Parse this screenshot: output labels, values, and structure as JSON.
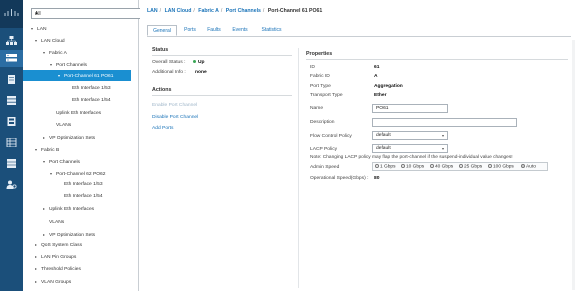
{
  "rail": {
    "icons": [
      "network-icon",
      "equipment-icon",
      "servers-icon",
      "lan-icon",
      "san-icon",
      "vm-icon",
      "storage-icon",
      "chassis-icon",
      "admin-icon"
    ]
  },
  "nav": {
    "filter_value": "All",
    "tree": [
      {
        "label": "LAN",
        "toggle": "▾"
      },
      {
        "label": "LAN Cloud",
        "toggle": "▾"
      },
      {
        "label": "Fabric A",
        "toggle": "▾"
      },
      {
        "label": "Port Channels",
        "toggle": "▾"
      },
      {
        "label": "Port-Channel 61 PO61",
        "toggle": "▾"
      },
      {
        "label": "Eth Interface 1/53",
        "toggle": ""
      },
      {
        "label": "Eth Interface 1/54",
        "toggle": ""
      },
      {
        "label": "Uplink Eth Interfaces",
        "toggle": ""
      },
      {
        "label": "VLANs",
        "toggle": ""
      },
      {
        "label": "VP Optimization Sets",
        "toggle": "▸"
      },
      {
        "label": "Fabric B",
        "toggle": "▾"
      },
      {
        "label": "Port Channels",
        "toggle": "▾"
      },
      {
        "label": "Port-Channel 62 PO62",
        "toggle": "▾"
      },
      {
        "label": "Eth Interface 1/53",
        "toggle": ""
      },
      {
        "label": "Eth Interface 1/54",
        "toggle": ""
      },
      {
        "label": "Uplink Eth Interfaces",
        "toggle": "▸"
      },
      {
        "label": "VLANs",
        "toggle": ""
      },
      {
        "label": "VP Optimization Sets",
        "toggle": "▸"
      },
      {
        "label": "QoS System Class",
        "toggle": "▸"
      },
      {
        "label": "LAN Pin Groups",
        "toggle": "▸"
      },
      {
        "label": "Threshold Policies",
        "toggle": "▸"
      },
      {
        "label": "VLAN Groups",
        "toggle": "▸"
      }
    ]
  },
  "breadcrumb": {
    "items": [
      "LAN",
      "LAN Cloud",
      "Fabric A",
      "Port Channels"
    ],
    "current": "Port-Channel 61 PO61",
    "separator": "/"
  },
  "tabs": [
    "General",
    "Ports",
    "Faults",
    "Events",
    "Statistics"
  ],
  "status": {
    "title": "Status",
    "overall_label": "Overall Status :",
    "overall_value": "Up",
    "additional_label": "Additional Info :",
    "additional_value": "none"
  },
  "actions": {
    "title": "Actions",
    "items": [
      "Enable Port Channel",
      "Disable Port Channel",
      "Add Ports"
    ]
  },
  "properties": {
    "title": "Properties",
    "id_label": "ID",
    "id_value": "61",
    "fabric_label": "Fabric ID",
    "fabric_value": "A",
    "port_type_label": "Port Type",
    "port_type_value": "Aggregation",
    "transport_label": "Transport Type",
    "transport_value": "Ether",
    "name_label": "Name",
    "name_value": "PO61",
    "description_label": "Description",
    "description_value": "",
    "flow_label": "Flow Control Policy",
    "flow_value": "default",
    "lacp_label": "LACP Policy",
    "lacp_value": "default",
    "note": "Note: Changing LACP policy may flap the port-channel if the suspend-individual value changes!",
    "admin_speed_label": "Admin Speed",
    "speed_options": [
      "1 Gbps",
      "10 Gbps",
      "40 Gbps",
      "25 Gbps",
      "100 Gbps",
      "Auto"
    ],
    "speed_selected": "Auto",
    "oper_speed_label": "Operational Speed(Gbps) :",
    "oper_speed_value": "80"
  },
  "colors": {
    "rail": "#1b4f7a",
    "selected": "#1a8fd1",
    "link": "#1a73b8",
    "status_up": "#3aa655"
  }
}
